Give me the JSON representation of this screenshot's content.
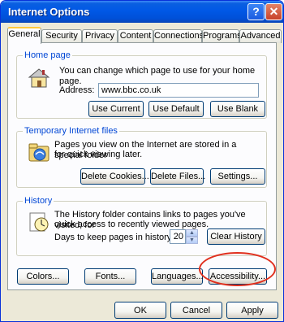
{
  "window": {
    "title": "Internet Options",
    "help_glyph": "?",
    "close_glyph": "✕"
  },
  "tabs": [
    {
      "label": "General",
      "active": true
    },
    {
      "label": "Security"
    },
    {
      "label": "Privacy"
    },
    {
      "label": "Content"
    },
    {
      "label": "Connections"
    },
    {
      "label": "Programs"
    },
    {
      "label": "Advanced"
    }
  ],
  "home_page": {
    "title": "Home page",
    "description": "You can change which page to use for your home page.",
    "address_label": "Address:",
    "address_value": "www.bbc.co.uk",
    "use_current": "Use Current",
    "use_default": "Use Default",
    "use_blank": "Use Blank",
    "icon": "home-page-icon"
  },
  "temp_files": {
    "title": "Temporary Internet files",
    "description_line1": "Pages you view on the Internet are stored in a special folder",
    "description_line2": "for quick viewing later.",
    "delete_cookies": "Delete Cookies...",
    "delete_files": "Delete Files...",
    "settings": "Settings...",
    "icon": "temp-files-icon"
  },
  "history": {
    "title": "History",
    "description_line1": "The History folder contains links to pages you've visited, for",
    "description_line2": "quick access to recently viewed pages.",
    "days_label": "Days to keep pages in history:",
    "days_value": "20",
    "clear_history": "Clear History",
    "icon": "history-icon"
  },
  "bottom_buttons": {
    "colors": "Colors...",
    "fonts": "Fonts...",
    "languages": "Languages...",
    "accessibility": "Accessibility..."
  },
  "dialog_buttons": {
    "ok": "OK",
    "cancel": "Cancel",
    "apply": "Apply"
  },
  "colors": {
    "titlebar": "#0058e6",
    "group_title": "#0046d5",
    "highlight": "#e0301e",
    "window_bg": "#ece9d8"
  }
}
